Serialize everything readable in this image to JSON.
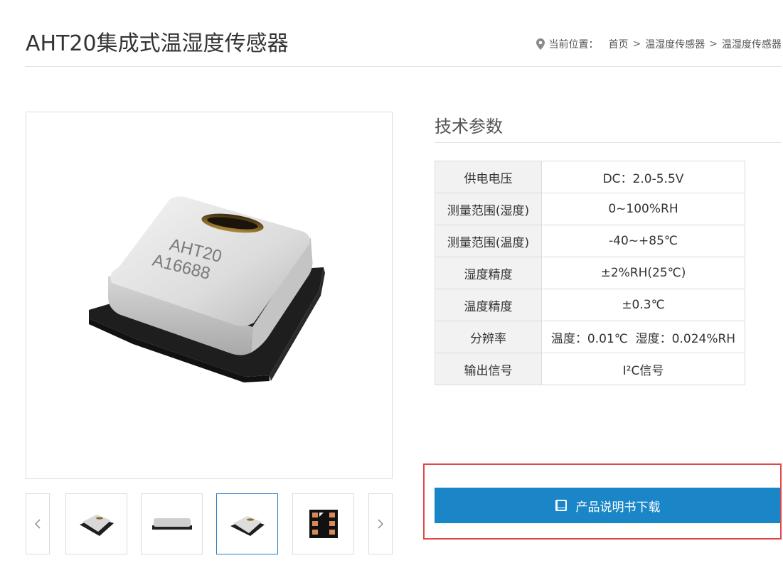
{
  "page": {
    "title": "AHT20集成式温湿度传感器"
  },
  "breadcrumb": {
    "label": "当前位置：",
    "items": [
      "首页",
      "温湿度传感器",
      "温湿度传感器"
    ],
    "separator": ">"
  },
  "product": {
    "chip_text_line1": "AHT20",
    "chip_text_line2": "A16688",
    "thumbnails_count": 4,
    "active_thumbnail": 3
  },
  "specs": {
    "title": "技术参数",
    "rows": [
      {
        "key": "供电电压",
        "value": "DC：2.0-5.5V"
      },
      {
        "key": "测量范围(湿度)",
        "value": "0~100%RH"
      },
      {
        "key": "测量范围(温度)",
        "value": "-40~+85℃"
      },
      {
        "key": "湿度精度",
        "value": "±2%RH(25℃)"
      },
      {
        "key": "温度精度",
        "value": "±0.3℃"
      },
      {
        "key": "分辨率",
        "value": "温度：0.01℃  湿度：0.024%RH"
      },
      {
        "key": "输出信号",
        "value": "I²C信号"
      }
    ]
  },
  "download": {
    "label": "产品说明书下载",
    "icon": "book-icon"
  },
  "colors": {
    "accent": "#1a86c8",
    "highlight": "#e04848"
  }
}
